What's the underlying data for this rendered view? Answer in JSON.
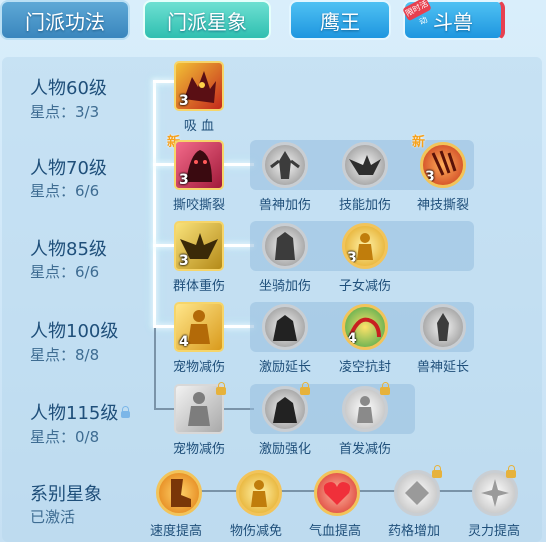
{
  "tabs": [
    {
      "label": "门派功法"
    },
    {
      "label": "门派星象"
    },
    {
      "label": "鹰王"
    },
    {
      "label": "斗兽"
    }
  ],
  "tab_badge": "限时活动",
  "rows": [
    {
      "level": "人物60级",
      "stars": "星点：3/3"
    },
    {
      "level": "人物70级",
      "stars": "星点：6/6"
    },
    {
      "level": "人物85级",
      "stars": "星点：6/6"
    },
    {
      "level": "人物100级",
      "stars": "星点：8/8"
    },
    {
      "level": "人物115级",
      "stars": "星点：0/8"
    },
    {
      "level": "系别星象",
      "stars": "已激活"
    }
  ],
  "new_tag": "新",
  "skills": {
    "r1": [
      {
        "name": "吸 血",
        "level": "3"
      }
    ],
    "r2": [
      {
        "name": "撕咬撕裂",
        "level": "3"
      },
      {
        "name": "兽神加伤"
      },
      {
        "name": "技能加伤"
      },
      {
        "name": "神技撕裂",
        "level": "3"
      }
    ],
    "r3": [
      {
        "name": "群体重伤",
        "level": "3"
      },
      {
        "name": "坐骑加伤"
      },
      {
        "name": "子女减伤",
        "level": "3"
      }
    ],
    "r4": [
      {
        "name": "宠物减伤",
        "level": "4"
      },
      {
        "name": "激励延长"
      },
      {
        "name": "凌空抗封",
        "level": "4"
      },
      {
        "name": "兽神延长"
      }
    ],
    "r5": [
      {
        "name": "宠物减伤"
      },
      {
        "name": "激励强化"
      },
      {
        "name": "首发减伤"
      }
    ],
    "bottom": [
      {
        "name": "速度提高"
      },
      {
        "name": "物伤减免"
      },
      {
        "name": "气血提高"
      },
      {
        "name": "药格增加"
      },
      {
        "name": "灵力提高"
      }
    ]
  }
}
